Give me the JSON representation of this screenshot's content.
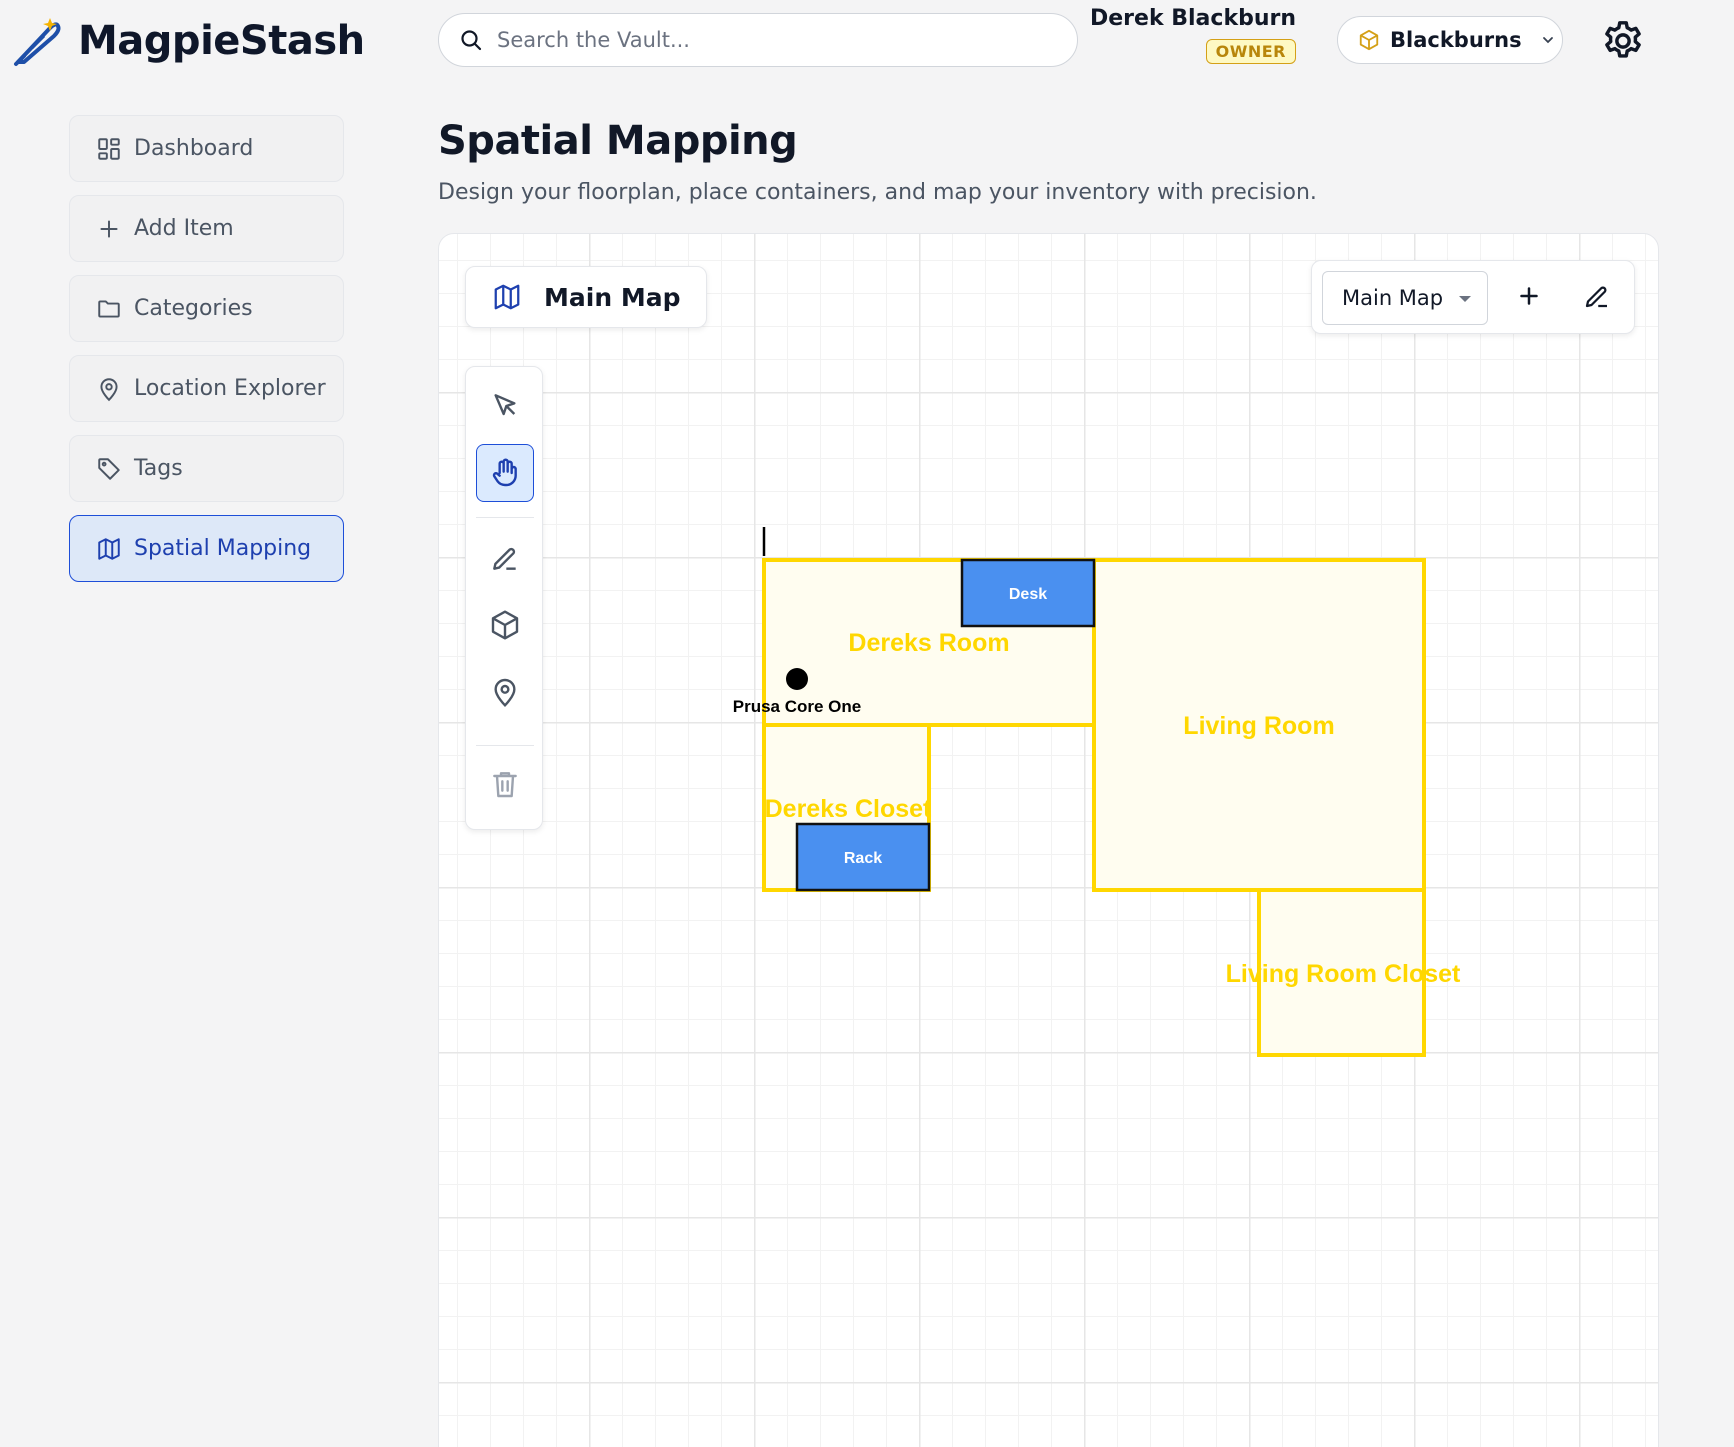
{
  "app": {
    "name": "MagpieStash"
  },
  "search": {
    "placeholder": "Search the Vault..."
  },
  "user": {
    "name": "Derek Blackburn",
    "role": "OWNER"
  },
  "household": {
    "name": "Blackburns"
  },
  "sidebar": {
    "items": [
      {
        "label": "Dashboard",
        "icon": "dashboard-icon"
      },
      {
        "label": "Add Item",
        "icon": "plus-icon"
      },
      {
        "label": "Categories",
        "icon": "folder-icon"
      },
      {
        "label": "Location Explorer",
        "icon": "map-pin-icon"
      },
      {
        "label": "Tags",
        "icon": "tag-icon"
      },
      {
        "label": "Spatial Mapping",
        "icon": "map-icon",
        "active": true
      }
    ]
  },
  "page": {
    "title": "Spatial Mapping",
    "subtitle": "Design your floorplan, place containers, and map your inventory with precision."
  },
  "map": {
    "current_name": "Main Map",
    "selector_value": "Main Map",
    "tools": [
      "select-tool",
      "pan-tool",
      "draw-tool",
      "container-tool",
      "location-tool",
      "delete-tool"
    ],
    "active_tool": "pan-tool",
    "rooms": [
      {
        "label": "Dereks Room"
      },
      {
        "label": "Living Room"
      },
      {
        "label": "Dereks Closet"
      },
      {
        "label": "Living Room Closet"
      }
    ],
    "containers": [
      {
        "label": "Desk"
      },
      {
        "label": "Rack"
      }
    ],
    "markers": [
      {
        "label": "Prusa Core One"
      }
    ]
  },
  "colors": {
    "accent": "#1d4ed8",
    "room_stroke": "#ffd700",
    "room_fill": "#fffdf0",
    "container_fill": "#4a90f0",
    "owner_badge": "#b8860b"
  }
}
